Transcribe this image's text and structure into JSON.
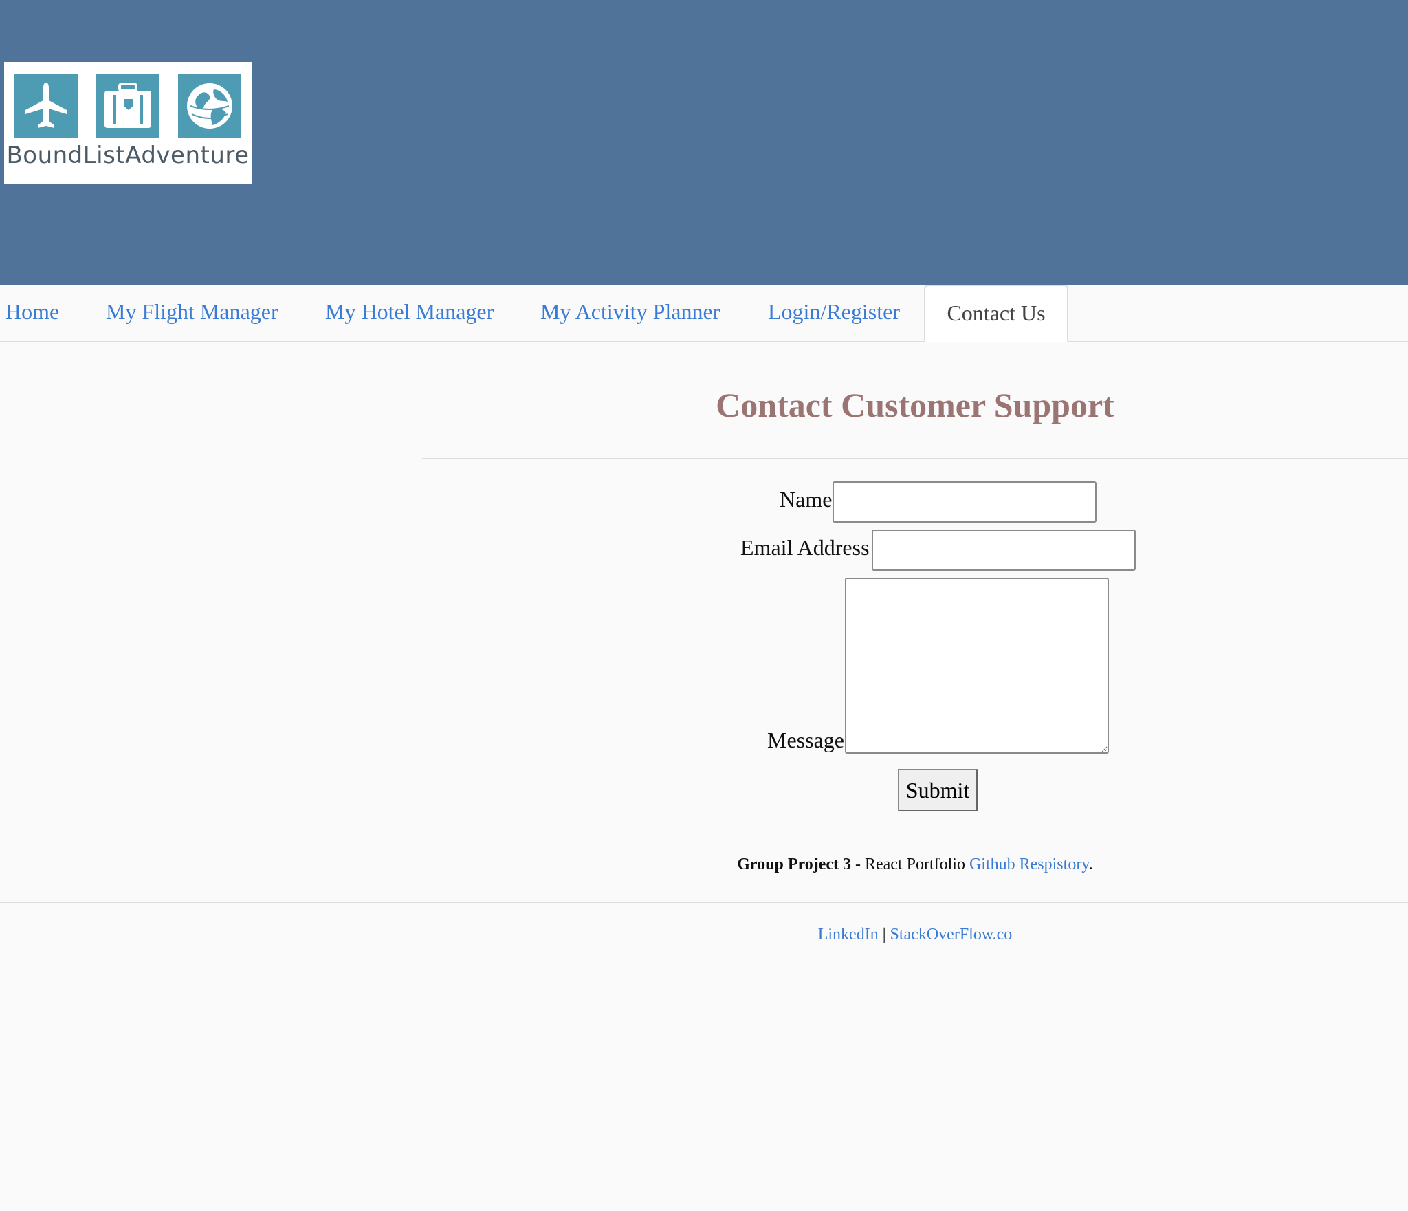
{
  "brand": {
    "logo_text": "BoundListAdventure",
    "icons": [
      "airplane-icon",
      "suitcase-icon",
      "globe-icon"
    ]
  },
  "nav": {
    "items": [
      {
        "label": "Home"
      },
      {
        "label": "My Flight Manager"
      },
      {
        "label": "My Hotel Manager"
      },
      {
        "label": "My Activity Planner"
      },
      {
        "label": "Login/Register"
      },
      {
        "label": "Contact Us",
        "active": true
      }
    ]
  },
  "main": {
    "title": "Contact Customer Support",
    "form": {
      "name_label": "Name",
      "name_value": "",
      "email_label": "Email Address",
      "email_value": "",
      "message_label": "Message",
      "message_value": "",
      "submit_label": "Submit"
    }
  },
  "credits": {
    "bold": "Group Project 3",
    "text": " - React Portfolio ",
    "link": "Github Respistory",
    "end": "."
  },
  "footer": {
    "linkedin": "LinkedIn",
    "separator": " | ",
    "stackoverflow": "StackOverFlow.co"
  },
  "colors": {
    "header_bg": "#4f7399",
    "logo_tile": "#4d9cb3",
    "link": "#3a7bd5",
    "title": "#9b7474"
  }
}
